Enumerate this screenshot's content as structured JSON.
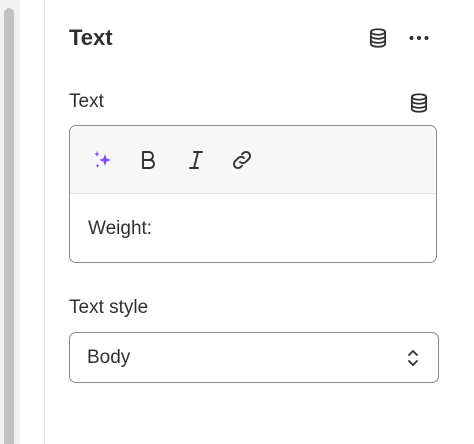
{
  "panel": {
    "title": "Text"
  },
  "text_field": {
    "label": "Text",
    "content": "Weight:"
  },
  "toolbar": {
    "icons": [
      "magic-icon",
      "bold-icon",
      "italic-icon",
      "link-icon"
    ]
  },
  "style_field": {
    "label": "Text style",
    "selected": "Body"
  },
  "colors": {
    "accent_magic": "#8051ff",
    "text": "#303030",
    "border": "#8a8a8a"
  }
}
